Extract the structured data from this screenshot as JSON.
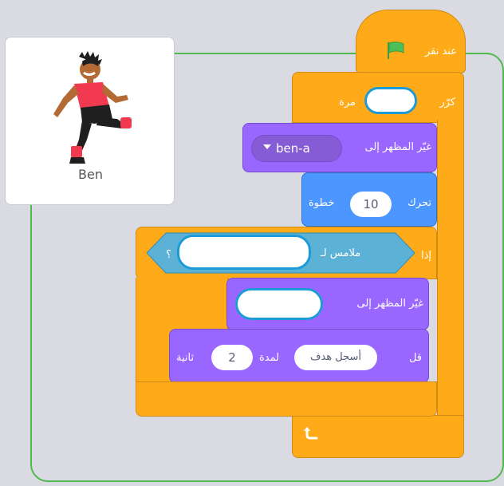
{
  "sprite": {
    "name": "Ben"
  },
  "script": {
    "hat_label": "عند نقر",
    "repeat_label": "كرّر",
    "repeat_times_label": "مرة",
    "switch_costume_label": "غيّر المظهر إلى",
    "costume_value": "ben-a",
    "move_label": "تحرك",
    "move_steps": "10",
    "steps_label": "خطوة",
    "if_label": "إذا",
    "touching_label": "ملامس لـ",
    "question_mark": "؟",
    "switch_costume_label_2": "غيّر المظهر إلى",
    "say_label": "قل",
    "say_text": "أسجل هدف",
    "for_label": "لمدة",
    "say_secs": "2",
    "secs_label": "ثانية"
  },
  "colors": {
    "control": "#ffab19",
    "looks": "#9966ff",
    "motion": "#4c97ff",
    "sensing": "#5cb1d6",
    "flag": "#4cbf56",
    "workspace_border": "#4fb94d"
  },
  "icons": [
    "green-flag-icon",
    "dropdown-arrow-icon",
    "loop-arrow-icon"
  ]
}
